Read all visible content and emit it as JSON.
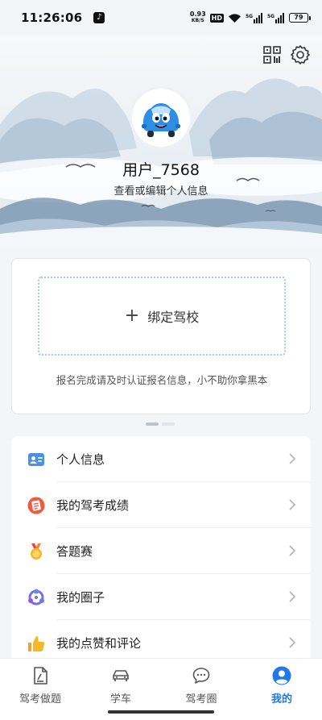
{
  "status_bar": {
    "time": "11:26:06",
    "net_speed_value": "0.93",
    "net_speed_unit": "KB/S",
    "hd_badge": "HD",
    "signal_1_label": "5G",
    "signal_2_label": "5G",
    "battery_level": "79"
  },
  "header": {
    "username": "用户_7568",
    "edit_link": "查看或编辑个人信息",
    "qr_icon": "qr-code-icon",
    "settings_icon": "gear-icon"
  },
  "bind_card": {
    "plus": "+",
    "label": "绑定驾校",
    "hint": "报名完成请及时认证报名信息，小不助你拿黑本"
  },
  "menu": {
    "items": [
      {
        "label": "个人信息",
        "icon": "id-card-icon"
      },
      {
        "label": "我的驾考成绩",
        "icon": "score-report-icon"
      },
      {
        "label": "答题赛",
        "icon": "medal-icon"
      },
      {
        "label": "我的圈子",
        "icon": "circle-group-icon"
      },
      {
        "label": "我的点赞和评论",
        "icon": "thumbs-up-icon"
      }
    ]
  },
  "bottom_nav": {
    "tabs": [
      {
        "label": "驾考做题",
        "icon": "exam-doc-icon",
        "active": false
      },
      {
        "label": "学车",
        "icon": "car-icon",
        "active": false
      },
      {
        "label": "驾考圈",
        "icon": "chat-bubble-icon",
        "active": false
      },
      {
        "label": "我的",
        "icon": "profile-icon",
        "active": true
      }
    ]
  },
  "colors": {
    "accent": "#1f7ae8",
    "bind_border": "#9ec9ee",
    "page_bg": "#f4f5f7"
  }
}
